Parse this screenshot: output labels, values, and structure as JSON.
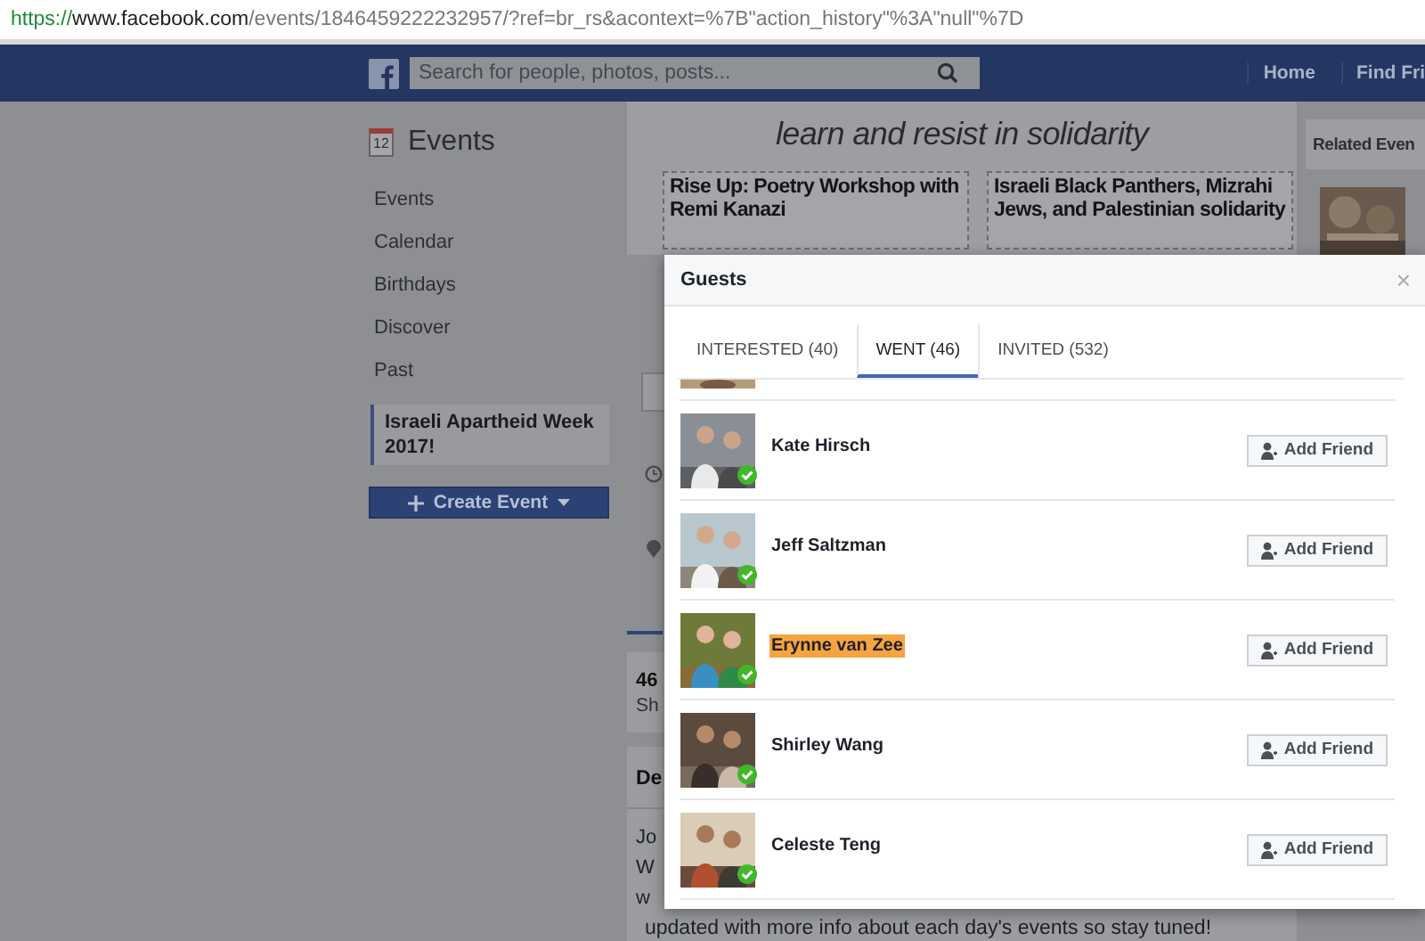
{
  "browser": {
    "url_scheme": "https://",
    "url_host": "www.facebook.com",
    "url_path": "/events/1846459222232957/?ref=br_rs&acontext=%7B\"action_history\"%3A\"null\"%7D"
  },
  "header": {
    "search_placeholder": "Search for people, photos, posts...",
    "nav": [
      "Home",
      "Find Fri"
    ]
  },
  "sidebar": {
    "title": "Events",
    "calendar_day": "12",
    "items": [
      {
        "label": "Events",
        "selected": false
      },
      {
        "label": "Calendar",
        "selected": false
      },
      {
        "label": "Birthdays",
        "selected": false
      },
      {
        "label": "Discover",
        "selected": false
      },
      {
        "label": "Past",
        "selected": false
      },
      {
        "label": "Israeli Apartheid Week 2017!",
        "selected": true
      }
    ],
    "create_button": "Create Event"
  },
  "event": {
    "banner_text": "learn and resist in solidarity",
    "posters": [
      "Rise Up: Poetry Workshop with Remi Kanazi",
      "Israeli Black Panthers, Mizrahi Jews, and Palestinian solidarity"
    ],
    "stats_count": "46",
    "stats_label": "Sh",
    "details_heading": "De",
    "details_lines": [
      "Jo",
      "W",
      "w"
    ],
    "details_last_line": "updated with more info about each day's events so stay tuned!"
  },
  "related": {
    "title": "Related Even"
  },
  "guests_dialog": {
    "title": "Guests",
    "close": "×",
    "tabs": [
      {
        "label": "INTERESTED (40)",
        "selected": false
      },
      {
        "label": "WENT (46)",
        "selected": true
      },
      {
        "label": "INVITED (532)",
        "selected": false
      }
    ],
    "guests": [
      {
        "name": "Kate Hirsch",
        "highlighted": false,
        "button": "Add Friend"
      },
      {
        "name": "Jeff Saltzman",
        "highlighted": false,
        "button": "Add Friend"
      },
      {
        "name": "Erynne van Zee",
        "highlighted": true,
        "button": "Add Friend"
      },
      {
        "name": "Shirley Wang",
        "highlighted": false,
        "button": "Add Friend"
      },
      {
        "name": "Celeste Teng",
        "highlighted": false,
        "button": "Add Friend"
      }
    ]
  }
}
